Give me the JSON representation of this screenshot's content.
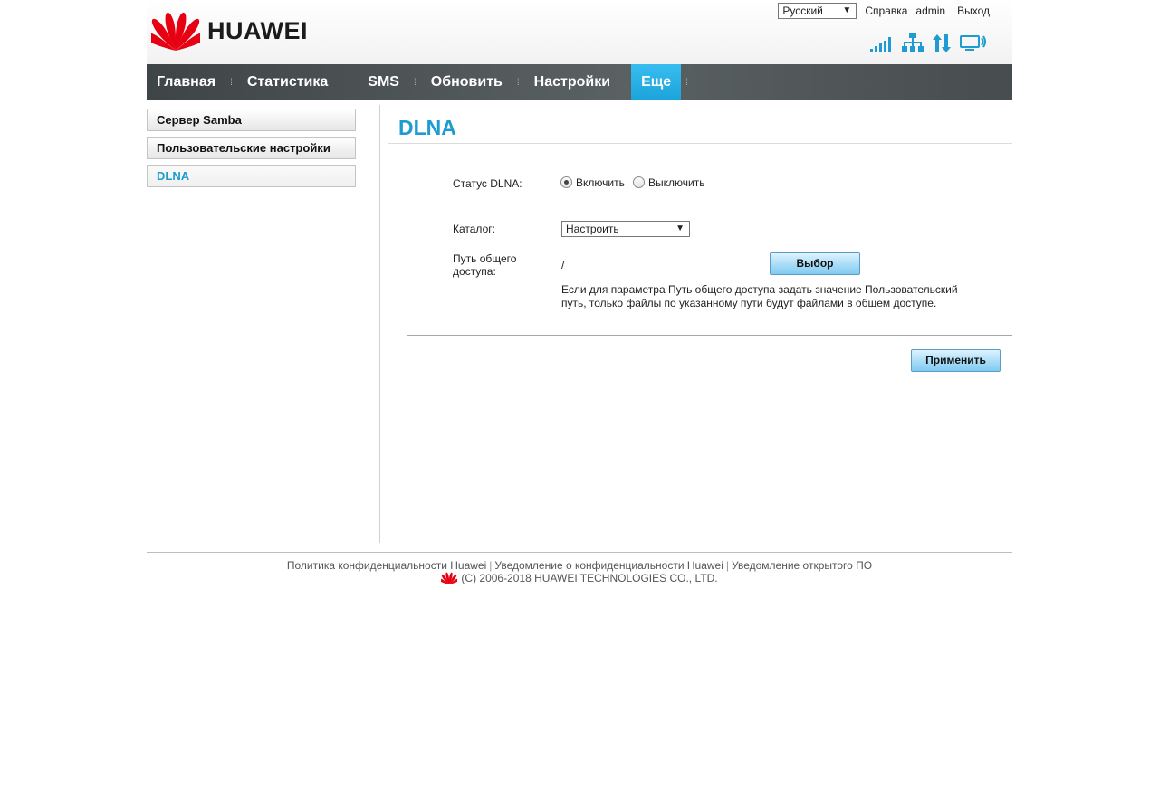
{
  "brand": {
    "name": "HUAWEI",
    "color": "#e60012"
  },
  "topbar": {
    "language": "Русский",
    "help": "Справка",
    "user": "admin",
    "logout": "Выход"
  },
  "status_icons": [
    "signal-strength-icon",
    "network-icon",
    "data-transfer-icon",
    "wifi-device-icon"
  ],
  "nav": {
    "items": [
      {
        "label": "Главная"
      },
      {
        "label": "Статистика"
      },
      {
        "label": "SMS"
      },
      {
        "label": "Обновить"
      },
      {
        "label": "Настройки"
      },
      {
        "label": "Еще",
        "active": true
      }
    ]
  },
  "sidebar": {
    "items": [
      {
        "label": "Сервер Samba"
      },
      {
        "label": "Пользовательские настройки"
      },
      {
        "label": "DLNA",
        "active": true
      }
    ]
  },
  "main": {
    "title": "DLNA",
    "status_label": "Статус DLNA:",
    "status_options": [
      {
        "label": "Включить",
        "checked": true
      },
      {
        "label": "Выключить",
        "checked": false
      }
    ],
    "catalog_label": "Каталог:",
    "catalog_value": "Настроить",
    "share_path_label_line1": "Путь общего",
    "share_path_label_line2": "доступа:",
    "share_path_value": "/",
    "browse_button": "Выбор",
    "note": "Если для параметра Путь общего доступа задать значение Пользовательский путь, только файлы по указанному пути будут файлами в общем доступе.",
    "apply_button": "Применить"
  },
  "footer": {
    "links": [
      "Политика конфиденциальности Huawei",
      "Уведомление о конфиденциальности Huawei",
      "Уведомление открытого ПО"
    ],
    "copyright": "(C) 2006-2018 HUAWEI TECHNOLOGIES CO., LTD."
  },
  "colors": {
    "accent": "#1e9bd0",
    "nav_active": "#29b4ea",
    "nav_bg": "#4a5153",
    "button": "#a8dcf6"
  }
}
